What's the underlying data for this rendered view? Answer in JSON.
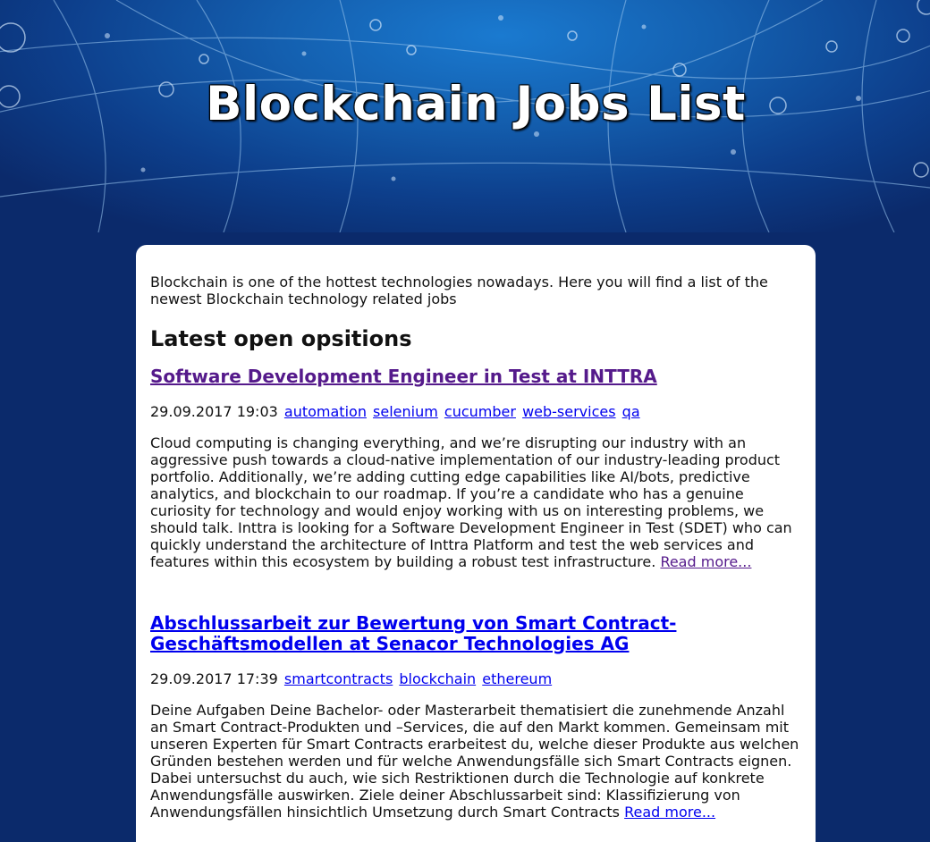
{
  "header": {
    "title": "Blockchain Jobs List"
  },
  "intro": "Blockchain is one of the hottest technologies nowadays. Here you will find a list of the newest Blockchain technology related jobs",
  "section_heading": "Latest open opsitions",
  "jobs": [
    {
      "title": "Software Development Engineer in Test at INTTRA",
      "datetime": "29.09.2017 19:03",
      "tags": [
        "automation",
        "selenium",
        "cucumber",
        "web-services",
        "qa"
      ],
      "description": "Cloud computing is changing everything, and we’re disrupting our industry with an aggressive push towards a cloud-native implementation of our industry-leading product portfolio. Additionally, we’re adding cutting edge capabilities like AI/bots, predictive analytics, and blockchain to our roadmap. If you’re a candidate who has a genuine curiosity for technology and would enjoy working with us on interesting problems, we should talk. Inttra is looking for a Software Development Engineer in Test (SDET) who can quickly understand the architecture of Inttra Platform and test the web services and features within this ecosystem by building a robust test infrastructure.",
      "read_more": "Read more..."
    },
    {
      "title": "Abschlussarbeit zur Bewertung von Smart Contract-Geschäftsmodellen at Senacor Technologies AG",
      "datetime": "29.09.2017 17:39",
      "tags": [
        "smartcontracts",
        "blockchain",
        "ethereum"
      ],
      "description": "Deine Aufgaben Deine Bachelor- oder Masterarbeit thematisiert die zunehmende Anzahl an Smart Contract-Produkten und –Services, die auf den Markt kommen. Gemeinsam mit unseren Experten für Smart Contracts erarbeitest du, welche dieser Produkte aus welchen Gründen bestehen werden und für welche Anwendungsfälle sich Smart Contracts eignen. Dabei untersuchst du auch, wie sich Restriktionen durch die Technologie auf konkrete Anwendungsfälle auswirken. Ziele deiner Abschlussarbeit sind: Klassifizierung von Anwendungsfällen hinsichtlich Umsetzung durch Smart Contracts",
      "read_more": "Read more..."
    }
  ],
  "colors": {
    "page_background": "#0b2a6b",
    "visited_link": "#551a8b",
    "unvisited_link": "#0000ee"
  }
}
